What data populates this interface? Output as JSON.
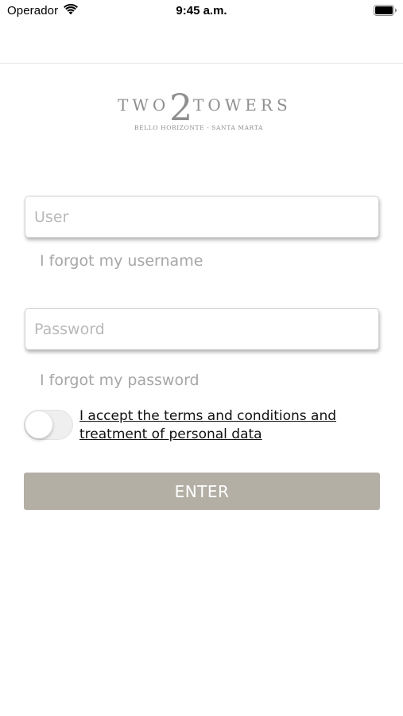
{
  "status_bar": {
    "carrier": "Operador",
    "time": "9:45 a.m.",
    "wifi_icon": "wifi-icon",
    "battery_icon": "battery-icon"
  },
  "logo": {
    "left_word": "TWO",
    "numeral": "2",
    "right_word": "TOWERS",
    "tagline": "BELLO HORIZONTE - SANTA MARTA",
    "color": "#8f8f8f"
  },
  "login_form": {
    "user_placeholder": "User",
    "user_value": "",
    "forgot_username_label": "I forgot my username",
    "password_placeholder": "Password",
    "password_value": "",
    "forgot_password_label": "I forgot my password",
    "terms_toggle_on": false,
    "terms_label": "I accept the terms and conditions and treatment of personal data",
    "enter_label": "ENTER"
  },
  "colors": {
    "enter_button": "#b3afa5",
    "link_gray": "#a6a6a6",
    "placeholder_gray": "#b9b9b9"
  }
}
